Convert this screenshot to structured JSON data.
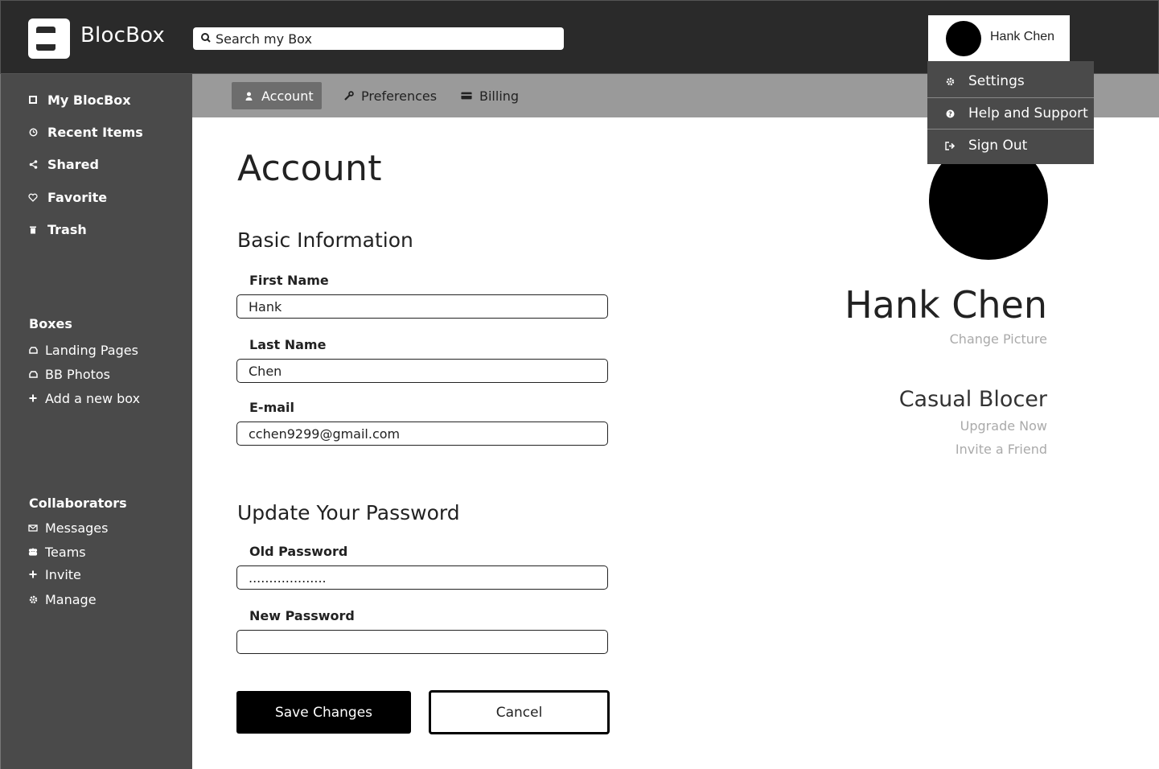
{
  "app": {
    "brand": "BlocBox"
  },
  "search": {
    "placeholder": "Search my Box"
  },
  "user": {
    "name": "Hank Chen"
  },
  "dropdown": [
    {
      "label": "Settings",
      "icon": "gear-icon"
    },
    {
      "label": "Help and Support",
      "icon": "help-icon"
    },
    {
      "label": "Sign Out",
      "icon": "sign-out-icon"
    }
  ],
  "sidebar": {
    "main": [
      {
        "label": "My BlocBox",
        "icon": "box-icon"
      },
      {
        "label": "Recent Items",
        "icon": "clock-icon"
      },
      {
        "label": "Shared",
        "icon": "share-icon"
      },
      {
        "label": "Favorite",
        "icon": "heart-icon"
      },
      {
        "label": "Trash",
        "icon": "trash-icon"
      }
    ],
    "boxes_title": "Boxes",
    "boxes": [
      {
        "label": "Landing Pages",
        "icon": "inbox-icon"
      },
      {
        "label": "BB Photos",
        "icon": "inbox-icon"
      },
      {
        "label": "Add a new box",
        "icon": "plus-icon"
      }
    ],
    "collab_title": "Collaborators",
    "collab": [
      {
        "label": "Messages",
        "icon": "envelope-icon"
      },
      {
        "label": "Teams",
        "icon": "team-icon"
      },
      {
        "label": "Invite",
        "icon": "plus-icon"
      },
      {
        "label": "Manage",
        "icon": "gear-icon"
      }
    ]
  },
  "tabs": [
    {
      "label": "Account",
      "icon": "user-icon",
      "active": true
    },
    {
      "label": "Preferences",
      "icon": "wrench-icon",
      "active": false
    },
    {
      "label": "Billing",
      "icon": "card-icon",
      "active": false
    }
  ],
  "page": {
    "title": "Account",
    "basic_title": "Basic Information",
    "first_name_label": "First Name",
    "first_name": "Hank",
    "last_name_label": "Last Name",
    "last_name": "Chen",
    "email_label": "E-mail",
    "email": "cchen9299@gmail.com",
    "password_title": "Update Your Password",
    "old_password_label": "Old Password",
    "old_password": "...................",
    "new_password_label": "New Password",
    "new_password": "",
    "save_label": "Save Changes",
    "cancel_label": "Cancel"
  },
  "profile": {
    "name": "Hank Chen",
    "change_picture": "Change Picture",
    "plan": "Casual Blocer",
    "upgrade": "Upgrade Now",
    "invite": "Invite a Friend"
  },
  "colors": {
    "topbar": "#2a2a2a",
    "sidebar": "#4a4a4a",
    "tabsbar": "#9a9a9a",
    "active_tab": "#6d6d6d",
    "muted_link": "#aaaaaa"
  }
}
